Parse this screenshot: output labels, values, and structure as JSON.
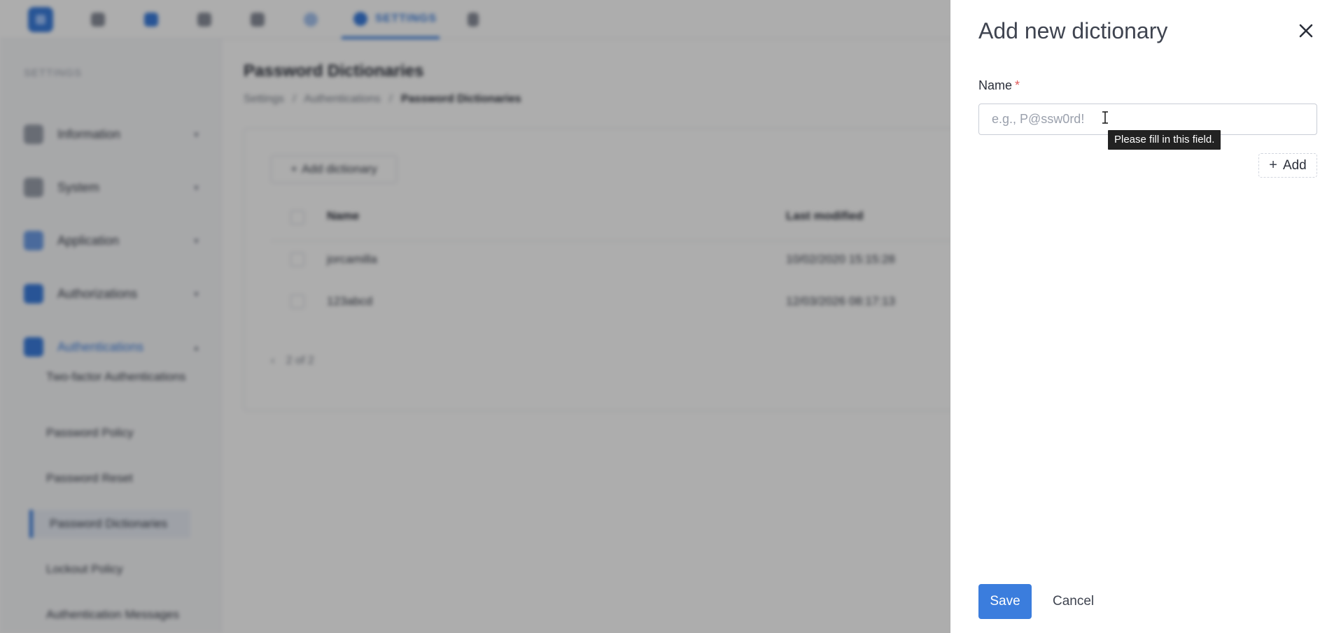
{
  "topbar": {
    "active_tab_label": "SETTINGS"
  },
  "sidebar": {
    "title": "SETTINGS",
    "groups": [
      {
        "label": "Information"
      },
      {
        "label": "System"
      },
      {
        "label": "Application"
      },
      {
        "label": "Authorizations"
      },
      {
        "label": "Authentications"
      }
    ],
    "sub_items": [
      {
        "label": "Two-factor Authentications"
      },
      {
        "label": "Password Policy"
      },
      {
        "label": "Password Reset"
      },
      {
        "label": "Password Dictionaries"
      },
      {
        "label": "Lockout Policy"
      },
      {
        "label": "Authentication Messages"
      }
    ]
  },
  "main": {
    "title": "Password Dictionaries",
    "breadcrumb": {
      "items": [
        "Settings",
        "Authentications",
        "Password Dictionaries"
      ],
      "separator": "/"
    },
    "add_button_label": "Add dictionary",
    "table": {
      "columns": [
        "Name",
        "Last modified"
      ],
      "rows": [
        {
          "name": "jorcamilla",
          "modified": "10/02/2020 15:15:28"
        },
        {
          "name": "123abcd",
          "modified": "12/03/2026 08:17:13"
        }
      ]
    },
    "pagination": "2 of 2"
  },
  "drawer": {
    "title": "Add new dictionary",
    "field_label": "Name",
    "required_mark": "*",
    "input_value": "",
    "input_placeholder": "e.g., P@ssw0rd!",
    "validation_tooltip": "Please fill in this field.",
    "add_button_label": "Add",
    "save_label": "Save",
    "cancel_label": "Cancel"
  },
  "colors": {
    "accent": "#3b7ddd",
    "required": "#e15b5b",
    "tooltip_bg": "#222222",
    "overlay": "rgba(0,0,0,0.32)"
  }
}
